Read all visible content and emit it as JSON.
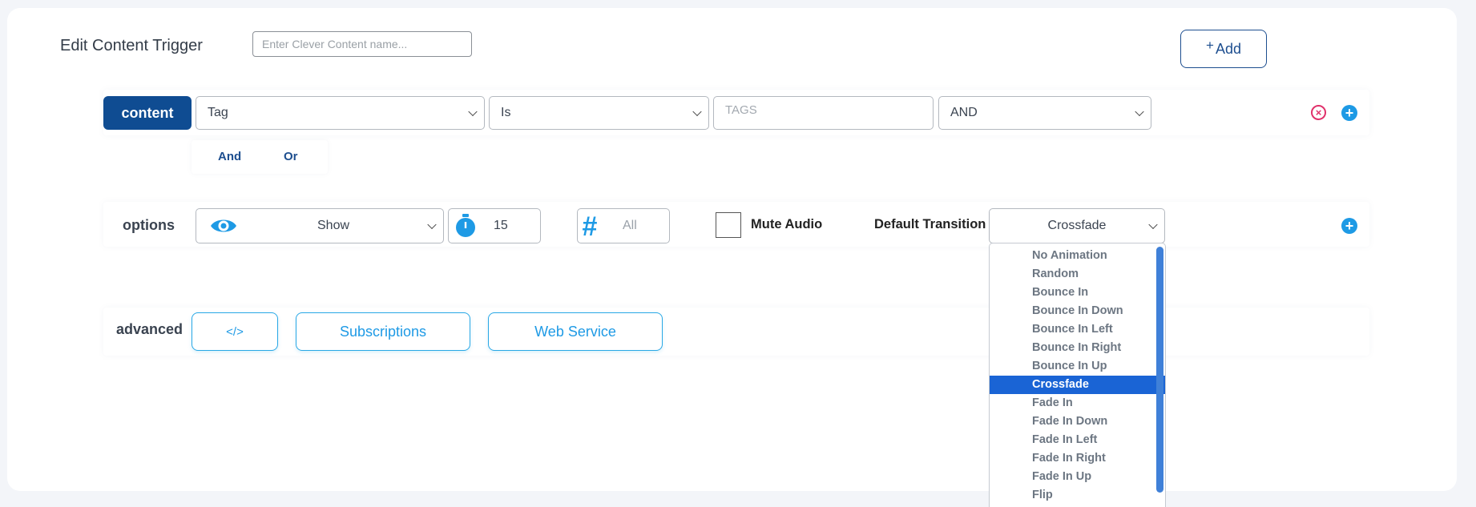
{
  "header": {
    "title": "Edit Content Trigger",
    "name_placeholder": "Enter Clever Content name...",
    "add_label": "Add",
    "add_icon": "plus-icon"
  },
  "content_row": {
    "label": "content",
    "field_select": "Tag",
    "operator_select": "Is",
    "tags_placeholder": "TAGS",
    "logic_select": "AND",
    "and_label": "And",
    "or_label": "Or",
    "remove_icon": "remove-circle-icon",
    "add_icon": "add-circle-icon"
  },
  "options_row": {
    "label": "options",
    "visibility_icon": "eye-icon",
    "visibility_select": "Show",
    "timer_icon": "stopwatch-icon",
    "timer_value": "15",
    "count_icon": "hash-icon",
    "count_value": "All",
    "mute_label": "Mute Audio",
    "mute_checked": false,
    "transition_label": "Default Transition",
    "transition_select": "Crossfade",
    "add_icon": "add-circle-icon"
  },
  "advanced_row": {
    "label": "advanced",
    "code_icon": "code-icon",
    "code_label": "</>",
    "subscriptions_label": "Subscriptions",
    "webservice_label": "Web Service"
  },
  "transition_dropdown": {
    "options": [
      "No Animation",
      "Random",
      "Bounce In",
      "Bounce In Down",
      "Bounce In Left",
      "Bounce In Right",
      "Bounce In Up",
      "Crossfade",
      "Fade In",
      "Fade In Down",
      "Fade In Left",
      "Fade In Right",
      "Fade In Up",
      "Flip"
    ],
    "selected": "Crossfade"
  },
  "colors": {
    "primary_dark": "#0f4c92",
    "accent_blue": "#1e9ae5",
    "remove_pink": "#e0306a",
    "selection_blue": "#1a64d5"
  }
}
